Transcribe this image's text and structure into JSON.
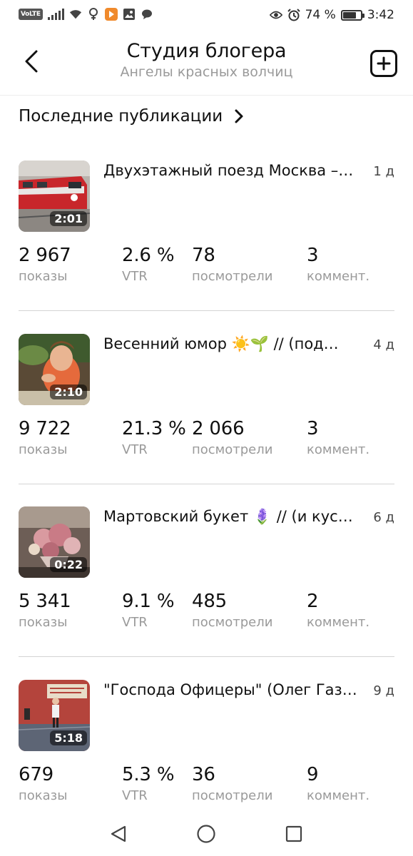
{
  "status_bar": {
    "volte": "VoLTE",
    "battery_percent": "74 %",
    "battery_level": 0.74,
    "time": "3:42",
    "icons": [
      "signal-icon",
      "wifi-icon",
      "vpn-icon",
      "media-app-icon",
      "gallery-icon",
      "chat-icon",
      "eye-icon",
      "alarm-icon",
      "battery-icon"
    ]
  },
  "header": {
    "title": "Студия блогера",
    "subtitle": "Ангелы красных волчиц",
    "back_icon": "chevron-left-icon",
    "add_icon": "plus-square-icon"
  },
  "section": {
    "title": "Последние публикации",
    "icon": "chevron-right-icon"
  },
  "posts": [
    {
      "title": "Двухэтажный поезд Москва –…",
      "age": "1 д",
      "duration": "2:01",
      "stats": [
        {
          "value": "2 967",
          "label": "показы"
        },
        {
          "value": "2.6 %",
          "label": "VTR"
        },
        {
          "value": "78",
          "label": "посмотрели"
        },
        {
          "value": "3",
          "label": "коммент."
        }
      ]
    },
    {
      "title": "Весенний юмор ☀️🌱 // (под…",
      "age": "4 д",
      "duration": "2:10",
      "stats": [
        {
          "value": "9 722",
          "label": "показы"
        },
        {
          "value": "21.3 %",
          "label": "VTR"
        },
        {
          "value": "2 066",
          "label": "посмотрели"
        },
        {
          "value": "3",
          "label": "коммент."
        }
      ]
    },
    {
      "title": "Мартовский букет 🪻 // (и кус…",
      "age": "6 д",
      "duration": "0:22",
      "stats": [
        {
          "value": "5 341",
          "label": "показы"
        },
        {
          "value": "9.1 %",
          "label": "VTR"
        },
        {
          "value": "485",
          "label": "посмотрели"
        },
        {
          "value": "2",
          "label": "коммент."
        }
      ]
    },
    {
      "title": "\"Господа Офицеры\" (Олег Газ…",
      "age": "9 д",
      "duration": "5:18",
      "stats": [
        {
          "value": "679",
          "label": "показы"
        },
        {
          "value": "5.3 %",
          "label": "VTR"
        },
        {
          "value": "36",
          "label": "посмотрели"
        },
        {
          "value": "9",
          "label": "коммент."
        }
      ]
    }
  ],
  "nav_bar": {
    "icons": [
      "back-triangle-icon",
      "home-circle-icon",
      "recents-square-icon"
    ]
  },
  "colors": {
    "primary_text": "#111111",
    "secondary_text": "#9a9a9a",
    "divider": "#d4d4d4",
    "media_app_accent": "#f08a2c"
  }
}
